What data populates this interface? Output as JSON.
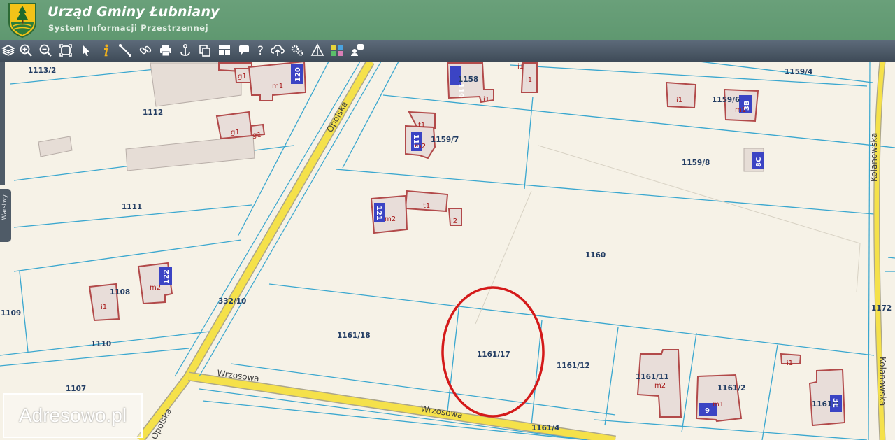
{
  "header": {
    "title": "Urząd Gminy Łubniany",
    "subtitle": "System Informacji Przestrzennej"
  },
  "toolbar": {
    "tools": [
      "layers-icon",
      "zoom-in-icon",
      "zoom-out-icon",
      "full-extent-icon",
      "select-arrow-icon",
      "info-icon",
      "measure-distance-icon",
      "link-icon",
      "print-icon",
      "anchor-icon",
      "copy-icon",
      "layout-icon",
      "comment-icon",
      "help-icon",
      "cloud-upload-icon",
      "settings-icon",
      "warning-icon",
      "color-palette-icon",
      "users-icon"
    ]
  },
  "side_panel": {
    "layers_label": "Warstwy"
  },
  "map": {
    "plots": [
      "1113/2",
      "1112",
      "1111",
      "1108",
      "1109",
      "1110",
      "1107",
      "332/10",
      "1158",
      "1159/7",
      "1159/4",
      "1159/6",
      "1159/8",
      "1160",
      "1161/18",
      "1161/17",
      "1161/12",
      "1161/11",
      "1161/2",
      "1161/1",
      "1161/4",
      "1172"
    ],
    "building_labels": [
      "g1",
      "m1",
      "g1",
      "g1",
      "i1",
      "i1",
      "i1",
      "t1",
      "m2",
      "m2",
      "t1",
      "i2",
      "m2",
      "i1",
      "i1",
      "m1",
      "m2",
      "m1",
      "i1"
    ],
    "house_numbers": [
      "120",
      "119",
      "113",
      "121",
      "122",
      "3B",
      "8C",
      "9",
      "3E"
    ],
    "streets": [
      "Opolska",
      "Opolska",
      "Kolanowska",
      "Kolanowska",
      "Wrzosowa",
      "Wrzosowa"
    ],
    "highlight_circle_target": "1161/17"
  },
  "watermark": "Adresowo.pl",
  "colors": {
    "header_green": "#6aa07a",
    "toolbar": "#4a5664",
    "road": "#f5e14a",
    "parcel_line": "#3aa7cf",
    "building_outline": "#b24a4a",
    "house_number_bg": "#3b44c4",
    "highlight": "#d41a1a"
  }
}
